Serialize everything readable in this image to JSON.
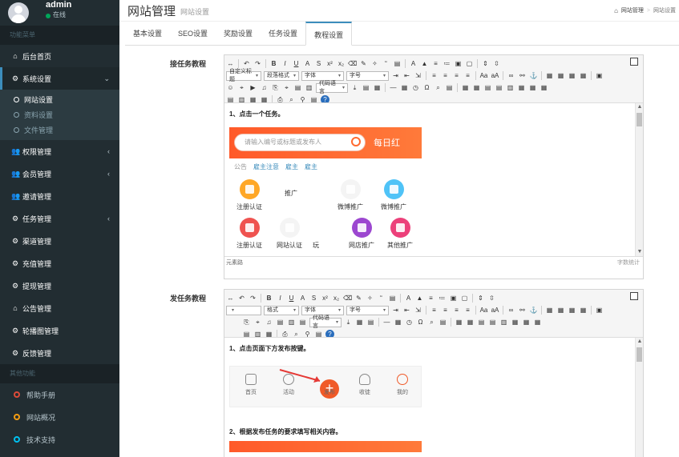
{
  "sidebar": {
    "user": {
      "name": "admin",
      "status": "在线"
    },
    "section_main": "功能菜单",
    "section_tools": "其他功能",
    "items": [
      {
        "label": "后台首页",
        "icon": "home-icon"
      },
      {
        "label": "系统设置",
        "icon": "gear-icon"
      },
      {
        "label": "权限管理",
        "icon": "users-icon"
      },
      {
        "label": "会员管理",
        "icon": "users-icon"
      },
      {
        "label": "邀请管理",
        "icon": "users-icon"
      },
      {
        "label": "任务管理",
        "icon": "gear-icon"
      },
      {
        "label": "渠道管理",
        "icon": "gear-icon"
      },
      {
        "label": "充值管理",
        "icon": "gear-icon"
      },
      {
        "label": "提现管理",
        "icon": "gear-icon"
      },
      {
        "label": "公告管理",
        "icon": "home-icon"
      },
      {
        "label": "轮播图管理",
        "icon": "gear-icon"
      },
      {
        "label": "反馈管理",
        "icon": "gear-icon"
      }
    ],
    "sub_items": [
      {
        "label": "网站设置"
      },
      {
        "label": "资料设置"
      },
      {
        "label": "文件管理"
      }
    ],
    "tools": [
      {
        "label": "帮助手册",
        "color": "#dd4b39"
      },
      {
        "label": "网站概况",
        "color": "#f39c12"
      },
      {
        "label": "技术支持",
        "color": "#00c0ef"
      }
    ]
  },
  "header": {
    "title": "网站管理",
    "subtitle": "网站设置",
    "breadcrumb": [
      "网站管理",
      "网站设置"
    ]
  },
  "tabs": [
    "基本设置",
    "SEO设置",
    "奖励设置",
    "任务设置",
    "教程设置"
  ],
  "form": {
    "label_receive": "接任务教程",
    "label_publish": "发任务教程"
  },
  "editor1": {
    "toolbar": {
      "custom_title": "自定义标题",
      "paragraph": "段落格式",
      "font": "字体",
      "size": "字号",
      "code": "代码语言"
    },
    "step1": "1、点击一个任务。",
    "mock": {
      "search_placeholder": "请输入编号或标题或发布人",
      "daily": "每日红",
      "tabs": [
        "公告",
        "雇主注意",
        "雇主",
        "雇主"
      ],
      "icons": [
        {
          "label": "注册认证"
        },
        {
          "label": "推广"
        },
        {
          "label": "微博推广"
        },
        {
          "label": "微博推广"
        },
        {
          "label": "注册认证"
        },
        {
          "label": "网站认证"
        },
        {
          "label": "玩"
        },
        {
          "label": "网店推广"
        },
        {
          "label": "其他推广"
        }
      ]
    },
    "footer_path": "元素路",
    "footer_count": "字数统计"
  },
  "editor2": {
    "toolbar": {
      "font": "字体",
      "size": "字号",
      "format": "格式",
      "code": "代码语言"
    },
    "step1": "1、点击页面下方发布按键。",
    "step2": "2、根据发布任务的要求填写相关内容。",
    "nav": [
      "首页",
      "活动",
      "发布",
      "收徒",
      "我的"
    ]
  },
  "colors": {
    "sidebar_bg": "#222d32",
    "accent": "#3c8dbc",
    "orange": "#ff5a2a"
  }
}
